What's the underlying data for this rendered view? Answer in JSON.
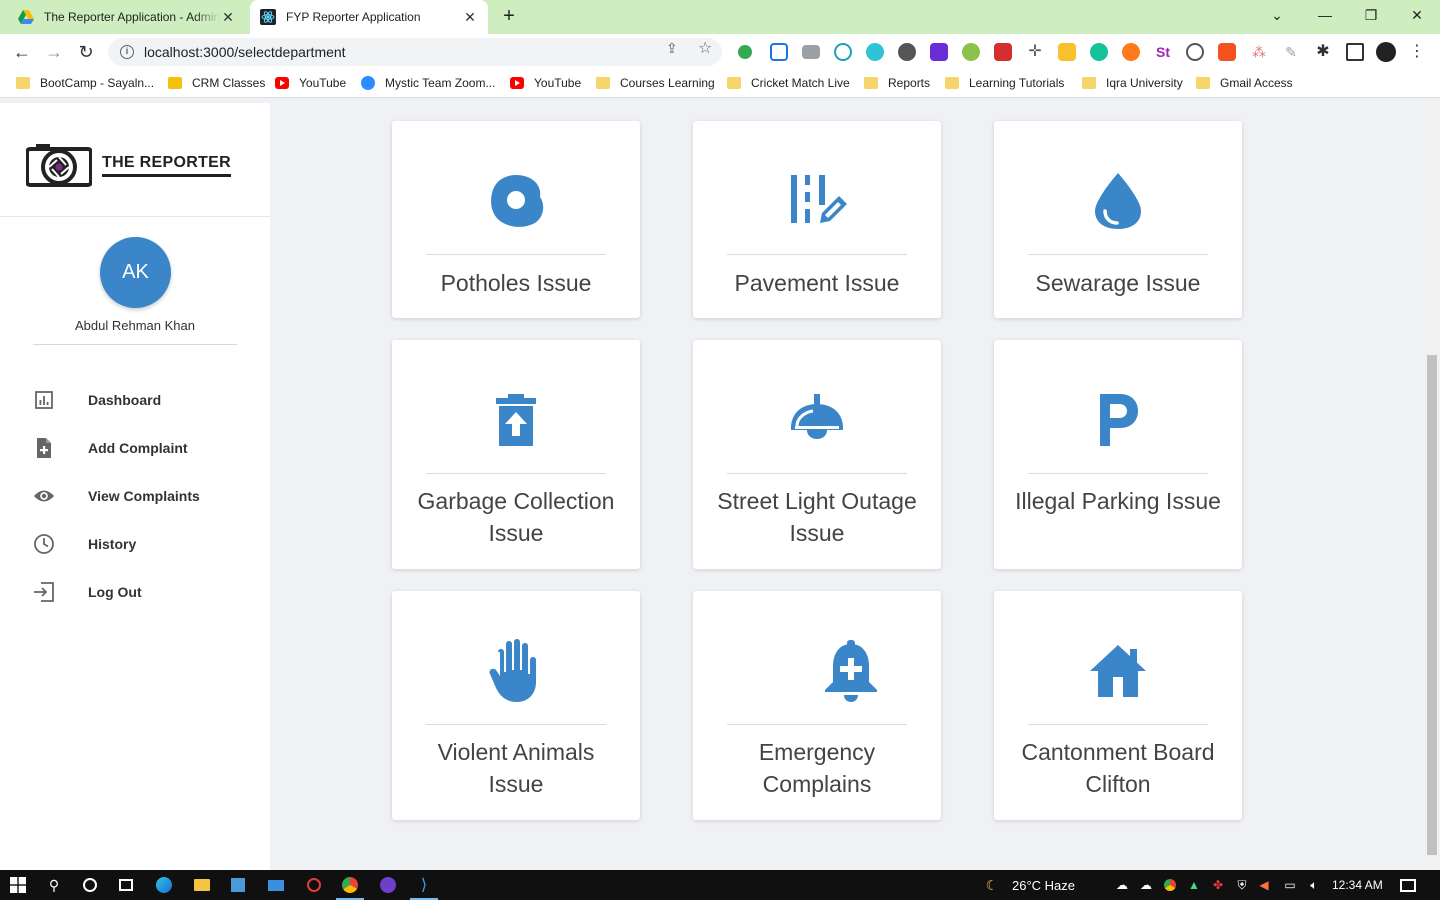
{
  "browser": {
    "tabs": [
      {
        "title": "The Reporter Application - Admin",
        "active": false
      },
      {
        "title": "FYP Reporter Application",
        "active": true
      }
    ],
    "url": "localhost:3000/selectdepartment",
    "bookmarks": [
      {
        "label": "BootCamp  - Sayaln...",
        "icon": "folder"
      },
      {
        "label": "CRM Classes",
        "icon": "classroom"
      },
      {
        "label": "YouTube",
        "icon": "youtube"
      },
      {
        "label": "Mystic Team Zoom...",
        "icon": "zoom"
      },
      {
        "label": "YouTube",
        "icon": "youtube"
      },
      {
        "label": "Courses Learning",
        "icon": "folder"
      },
      {
        "label": "Cricket Match Live",
        "icon": "folder"
      },
      {
        "label": "Reports",
        "icon": "folder"
      },
      {
        "label": "Learning Tutorials",
        "icon": "folder"
      },
      {
        "label": "Iqra University",
        "icon": "folder"
      },
      {
        "label": "Gmail Access",
        "icon": "folder"
      }
    ]
  },
  "app": {
    "brand": "THE REPORTER",
    "user": {
      "initials": "AK",
      "name": "Abdul Rehman Khan"
    },
    "menu": [
      {
        "label": "Dashboard",
        "icon": "bar-chart-icon"
      },
      {
        "label": "Add Complaint",
        "icon": "add-file-icon"
      },
      {
        "label": "View Complaints",
        "icon": "eye-icon"
      },
      {
        "label": "History",
        "icon": "clock-icon"
      },
      {
        "label": "Log Out",
        "icon": "logout-icon"
      }
    ],
    "departments": [
      {
        "label": "Potholes Issue",
        "icon": "pothole-icon"
      },
      {
        "label": "Pavement Issue",
        "icon": "pavement-icon"
      },
      {
        "label": "Sewarage Issue",
        "icon": "water-drop-icon"
      },
      {
        "label": "Garbage Collection Issue",
        "icon": "trash-upload-icon"
      },
      {
        "label": "Street Light Outage Issue",
        "icon": "ceiling-light-icon"
      },
      {
        "label": "Illegal Parking Issue",
        "icon": "parking-icon"
      },
      {
        "label": "Violent Animals Issue",
        "icon": "hand-icon"
      },
      {
        "label": "Emergency Complains",
        "icon": "alarm-plus-icon"
      },
      {
        "label": "Cantonment Board Clifton",
        "icon": "house-icon"
      }
    ],
    "accent_color": "#3a86c8"
  },
  "taskbar": {
    "weather": "26°C  Haze",
    "time": "12:34 AM"
  }
}
